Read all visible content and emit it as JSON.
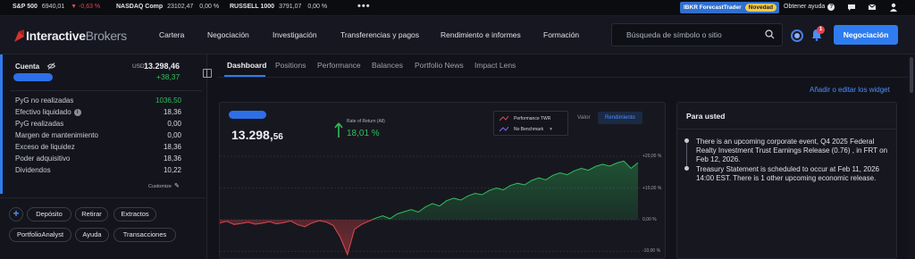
{
  "ticker": [
    {
      "name": "S&P 500",
      "value": "6940,01",
      "change": "▼ -0,63 %",
      "dir": "neg"
    },
    {
      "name": "NASDAQ Comp",
      "value": "23102,47",
      "change": "0,00 %",
      "dir": "flat"
    },
    {
      "name": "RUSSELL 1000",
      "value": "3791,07",
      "change": "0,00 %",
      "dir": "flat"
    }
  ],
  "more": "•••",
  "promo": {
    "label": "IBKR ForecastTrader",
    "badge": "Novedad"
  },
  "help": "Obtener ayuda",
  "logo": {
    "bold": "Interactive",
    "light": "Brokers"
  },
  "nav": [
    "Cartera",
    "Negociación",
    "Investigación",
    "Transferencias y pagos",
    "Rendimiento e informes",
    "Formación"
  ],
  "search": {
    "placeholder": "Búsqueda de símbolo o sitio"
  },
  "notif_count": "1",
  "trade_button": "Negociación",
  "account": {
    "title": "Cuenta",
    "currency": "USD",
    "value": "13.298,46",
    "change": "+38,37",
    "rows": [
      {
        "label": "PyG no realizadas",
        "value": "1036,50",
        "info": false,
        "pos": true
      },
      {
        "label": "Efectivo liquidado",
        "value": "18,36",
        "info": true,
        "pos": false
      },
      {
        "label": "PyG realizadas",
        "value": "0,00",
        "info": false,
        "pos": false
      },
      {
        "label": "Margen de mantenimiento",
        "value": "0,00",
        "info": false,
        "pos": false
      },
      {
        "label": "Exceso de liquidez",
        "value": "18,36",
        "info": false,
        "pos": false
      },
      {
        "label": "Poder adquisitivo",
        "value": "18,36",
        "info": false,
        "pos": false
      },
      {
        "label": "Dividendos",
        "value": "10,22",
        "info": false,
        "pos": false
      }
    ],
    "customize": "Customize"
  },
  "actions": [
    "Depósito",
    "Retirar",
    "Extractos",
    "PortfolioAnalyst",
    "Ayuda",
    "Transacciones"
  ],
  "tabs": [
    "Dashboard",
    "Positions",
    "Performance",
    "Balances",
    "Portfolio News",
    "Impact Lens"
  ],
  "add_widget": "Añadir o editar los widget",
  "performance": {
    "value_main": "13.298,",
    "value_dec": "56",
    "ror_label": "Rate of Return (All)",
    "ror_value": "18,01 %",
    "legend": [
      "Performance TWR",
      "No Benchmark"
    ],
    "valor_label": "Valor",
    "rend_button": "Rendimiento",
    "colors": {
      "pos": "#2fbf5b",
      "neg": "#e0464f"
    }
  },
  "chart_data": {
    "type": "line",
    "title": "",
    "series": [
      {
        "name": "Performance TWR",
        "values": [
          -1.0,
          -0.5,
          -1.5,
          -1.2,
          -0.8,
          -1.4,
          -1.1,
          -0.6,
          -1.3,
          -0.9,
          -0.4,
          -1.6,
          -2.2,
          -1.0,
          -0.3,
          -0.7,
          -1.8,
          -5.5,
          -11.0,
          -3.0,
          -1.5,
          -0.5,
          0.5,
          1.2,
          0.3,
          1.8,
          2.5,
          3.2,
          2.4,
          4.0,
          5.1,
          4.3,
          6.0,
          6.8,
          6.2,
          7.5,
          8.3,
          7.9,
          9.2,
          10.0,
          9.4,
          10.8,
          11.5,
          11.0,
          12.4,
          13.2,
          12.6,
          14.0,
          14.8,
          14.2,
          15.4,
          16.2,
          15.6,
          16.8,
          17.5,
          16.9,
          17.9,
          18.5,
          16.2,
          18.01
        ]
      }
    ],
    "yticks": [
      "+20,00 %",
      "+10,00 %",
      "0,00 %",
      "-10,00 %"
    ],
    "ylim": [
      -12,
      22
    ],
    "grid": true
  },
  "para_usted": {
    "title": "Para usted",
    "items": [
      "There is an upcoming corporate event, Q4 2025 Federal Realty Investment Trust Earnings Release (0.76) , in FRT on Feb 12, 2026.",
      "Treasury Statement is scheduled to occur at Feb 11, 2026 14:00 EST. There is 1 other upcoming economic release."
    ]
  }
}
